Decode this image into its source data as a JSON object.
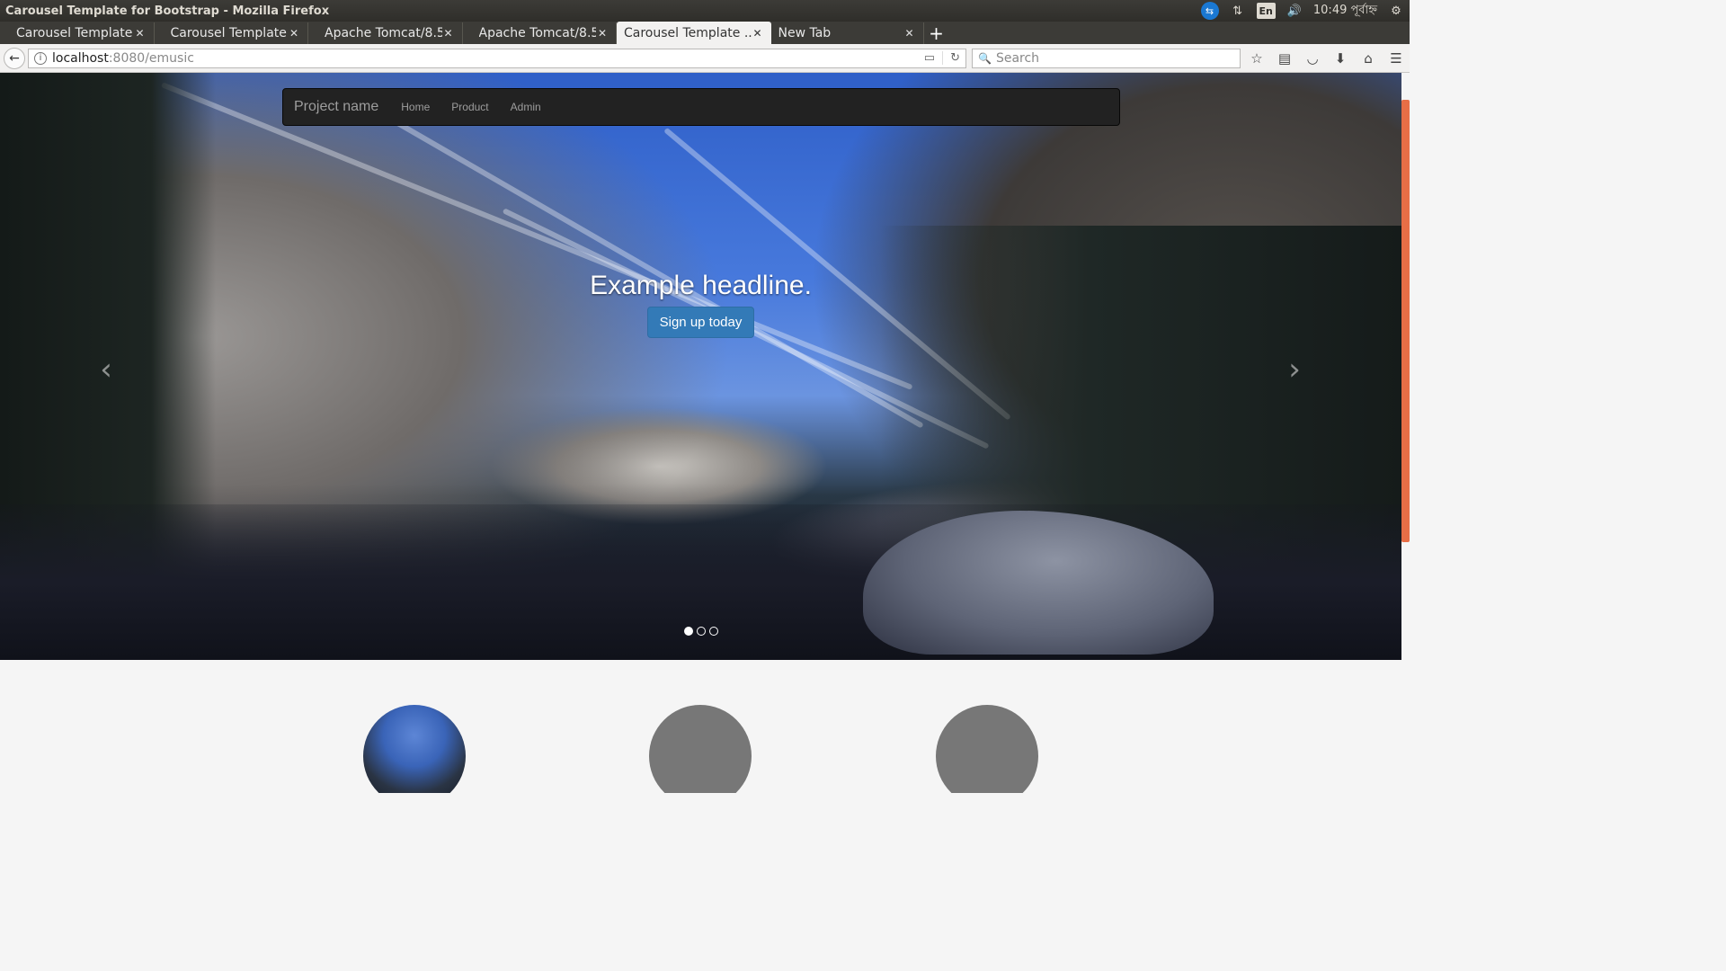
{
  "os": {
    "window_title": "Carousel Template for Bootstrap - Mozilla Firefox",
    "keyboard": "En",
    "clock": "10:49 পূর্বাহ্ন"
  },
  "tabs": [
    {
      "label": "Carousel Template ..."
    },
    {
      "label": "Carousel Template ..."
    },
    {
      "label": "Apache Tomcat/8.5...."
    },
    {
      "label": "Apache Tomcat/8.5...."
    },
    {
      "label": "Carousel Template ..."
    },
    {
      "label": "New Tab"
    }
  ],
  "urlbar": {
    "host": "localhost",
    "path": ":8080/emusic"
  },
  "search": {
    "placeholder": "Search"
  },
  "site": {
    "brand": "Project name",
    "nav": [
      "Home",
      "Product",
      "Admin"
    ]
  },
  "carousel": {
    "headline": "Example headline.",
    "button": "Sign up today",
    "prev_icon": "chevron-left",
    "next_icon": "chevron-right",
    "slides": 3,
    "active_slide": 1
  },
  "colors": {
    "accent": "#337ab7",
    "navbar": "#222222",
    "scroll_thumb": "#e76e46"
  }
}
